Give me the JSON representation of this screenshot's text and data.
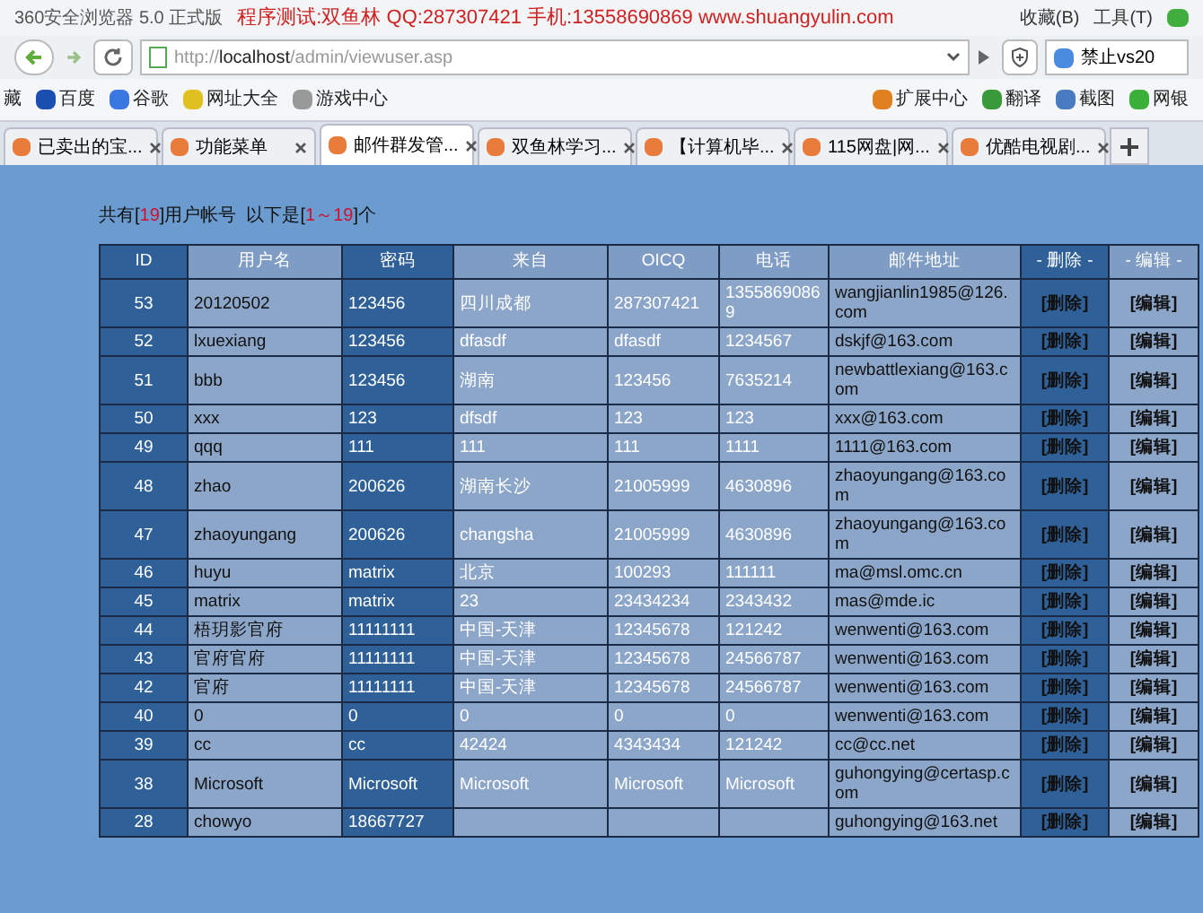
{
  "window": {
    "title": "360安全浏览器 5.0 正式版",
    "caption": "程序测试:双鱼林 QQ:287307421 手机:13558690869 www.shuangyulin.com",
    "menu": [
      "收藏(B)",
      "工具(T)"
    ]
  },
  "address_bar": {
    "host_prefix": "http://",
    "host": "localhost",
    "path": "/admin/viewuser.asp",
    "search_value": "禁止vs20"
  },
  "bookmarks": {
    "left": [
      "藏",
      "百度",
      "谷歌",
      "网址大全",
      "游戏中心"
    ],
    "right": [
      "扩展中心",
      "翻译",
      "截图",
      "网银"
    ]
  },
  "tabs": [
    {
      "label": "已卖出的宝...",
      "selected": false
    },
    {
      "label": "功能菜单",
      "selected": false
    },
    {
      "label": "邮件群发管...",
      "selected": true
    },
    {
      "label": "双鱼林学习...",
      "selected": false
    },
    {
      "label": "【计算机毕...",
      "selected": false
    },
    {
      "label": "115网盘|网...",
      "selected": false
    },
    {
      "label": "优酷电视剧...",
      "selected": false
    }
  ],
  "summary": "共有[**19**]用户帐号  以下是[**1～19**]个",
  "table": {
    "columns": [
      "ID",
      "用户名",
      "密码",
      "来自",
      "OICQ",
      "电话",
      "邮件地址",
      "- 删除 -",
      "- 编辑 -"
    ],
    "rows": [
      [
        "53",
        "20120502",
        "123456",
        "四川成都",
        "287307421",
        "13558690869",
        "wangjianlin1985@126.com",
        "[删除]",
        "[编辑]"
      ],
      [
        "52",
        "lxuexiang",
        "123456",
        "dfasdf",
        "dfasdf",
        "1234567",
        "dskjf@163.com",
        "[删除]",
        "[编辑]"
      ],
      [
        "51",
        "bbb",
        "123456",
        "湖南",
        "123456",
        "7635214",
        "newbattlexiang@163.com",
        "[删除]",
        "[编辑]"
      ],
      [
        "50",
        "xxx",
        "123",
        "dfsdf",
        "123",
        "123",
        "xxx@163.com",
        "[删除]",
        "[编辑]"
      ],
      [
        "49",
        "qqq",
        "111",
        "111",
        "111",
        "1111",
        "1111@163.com",
        "[删除]",
        "[编辑]"
      ],
      [
        "48",
        "zhao",
        "200626",
        "湖南长沙",
        "21005999",
        "4630896",
        "zhaoyungang@163.com",
        "[删除]",
        "[编辑]"
      ],
      [
        "47",
        "zhaoyungang",
        "200626",
        "changsha",
        "21005999",
        "4630896",
        "zhaoyungang@163.com",
        "[删除]",
        "[编辑]"
      ],
      [
        "46",
        "huyu",
        "matrix",
        "北京",
        "100293",
        "111111",
        "ma@msl.omc.cn",
        "[删除]",
        "[编辑]"
      ],
      [
        "45",
        "matrix",
        "matrix",
        "23",
        "23434234",
        "2343432",
        "mas@mde.ic",
        "[删除]",
        "[编辑]"
      ],
      [
        "44",
        "梧玥影官府",
        "11111111",
        "中国-天津",
        "12345678",
        "121242",
        "wenwenti@163.com",
        "[删除]",
        "[编辑]"
      ],
      [
        "43",
        "官府官府",
        "11111111",
        "中国-天津",
        "12345678",
        "24566787",
        "wenwenti@163.com",
        "[删除]",
        "[编辑]"
      ],
      [
        "42",
        "官府",
        "11111111",
        "中国-天津",
        "12345678",
        "24566787",
        "wenwenti@163.com",
        "[删除]",
        "[编辑]"
      ],
      [
        "40",
        "0",
        "0",
        "0",
        "0",
        "0",
        "wenwenti@163.com",
        "[删除]",
        "[编辑]"
      ],
      [
        "39",
        "cc",
        "cc",
        "42424",
        "4343434",
        "121242",
        "cc@cc.net",
        "[删除]",
        "[编辑]"
      ],
      [
        "38",
        "Microsoft",
        "Microsoft",
        "Microsoft",
        "Microsoft",
        "Microsoft",
        "guhongying@certasp.com",
        "[删除]",
        "[编辑]"
      ],
      [
        "28",
        "chowyo",
        "18667727",
        "",
        "",
        "",
        "guhongying@163.net",
        "[删除]",
        "[编辑]"
      ]
    ]
  }
}
